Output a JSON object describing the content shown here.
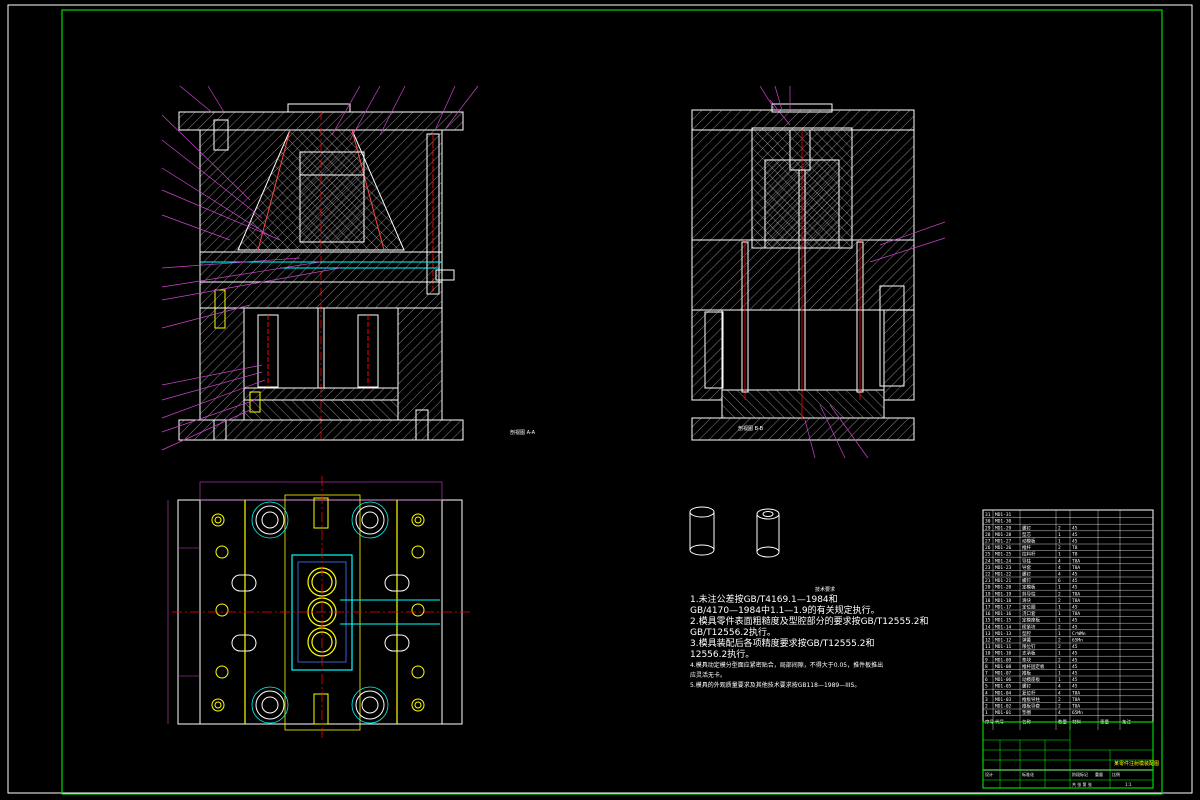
{
  "drawing": {
    "section_label_left": "剖视图 A-A",
    "section_label_right": "剖视图 B-B",
    "tech_requirements": {
      "heading": "技术要求",
      "lines": [
        "1.未注公差按GB/T4169.1—1984和",
        "GB/4170—1984中1.1—1.9的有关规定执行。",
        "2.模具零件表面粗糙度及型腔部分的要求按GB/T12555.2和",
        "GB/T12556.2执行。",
        "3.模具装配后各项精度要求按GB/T12555.2和",
        "12556.2执行。",
        "4.模具动定模分型面应紧密贴合，局部间隙，不得大于0.05，推件板推出",
        "应灵活无卡。",
        "5.模具的外观质量要求及其他技术要求按GB118—1989—IIIS。"
      ]
    },
    "title_block": {
      "drawing_title": "某零件注射模装配图",
      "rows_left": [
        "标记",
        "处数",
        "分区",
        "更改文件号",
        "签名",
        "年月日"
      ],
      "designer": "设计",
      "standard": "标准化",
      "stage": "阶段标记",
      "weight": "重量",
      "scale": "比例",
      "sheet": "共 张 第 张",
      "scale_value": "1:1"
    },
    "bom": {
      "headers": [
        "序号",
        "代号",
        "名称",
        "数量",
        "材料",
        "重量",
        "备注"
      ],
      "rows": [
        [
          "31",
          "MD1-31",
          "",
          "",
          "",
          ""
        ],
        [
          "30",
          "MD1-30",
          "",
          "",
          "",
          ""
        ],
        [
          "29",
          "MD1-29",
          "螺钉",
          "2",
          "45",
          ""
        ],
        [
          "28",
          "MD1-28",
          "型芯",
          "1",
          "45",
          ""
        ],
        [
          "27",
          "MD1-27",
          "动模板",
          "1",
          "45",
          ""
        ],
        [
          "26",
          "MD1-26",
          "推杆",
          "2",
          "T8",
          ""
        ],
        [
          "25",
          "MD1-25",
          "拉料杆",
          "1",
          "T8",
          ""
        ],
        [
          "24",
          "MD1-24",
          "导柱",
          "4",
          "T8A",
          ""
        ],
        [
          "23",
          "MD1-23",
          "导套",
          "4",
          "T8A",
          ""
        ],
        [
          "22",
          "MD1-22",
          "螺钉",
          "4",
          "45",
          ""
        ],
        [
          "21",
          "MD1-21",
          "螺钉",
          "6",
          "45",
          ""
        ],
        [
          "20",
          "MD1-20",
          "定模板",
          "1",
          "45",
          ""
        ],
        [
          "19",
          "MD1-19",
          "斜导柱",
          "2",
          "T8A",
          ""
        ],
        [
          "18",
          "MD1-18",
          "滑块",
          "2",
          "T8A",
          ""
        ],
        [
          "17",
          "MD1-17",
          "定位圈",
          "1",
          "45",
          ""
        ],
        [
          "16",
          "MD1-16",
          "浇口套",
          "1",
          "T8A",
          ""
        ],
        [
          "15",
          "MD1-15",
          "定模座板",
          "1",
          "45",
          ""
        ],
        [
          "14",
          "MD1-14",
          "楔紧块",
          "2",
          "45",
          ""
        ],
        [
          "13",
          "MD1-13",
          "型腔",
          "1",
          "CrWMn",
          ""
        ],
        [
          "12",
          "MD1-12",
          "弹簧",
          "2",
          "65Mn",
          ""
        ],
        [
          "11",
          "MD1-11",
          "限位钉",
          "2",
          "45",
          ""
        ],
        [
          "10",
          "MD1-10",
          "支承板",
          "1",
          "45",
          ""
        ],
        [
          "9",
          "MD1-09",
          "垫块",
          "2",
          "45",
          ""
        ],
        [
          "8",
          "MD1-08",
          "推杆固定板",
          "1",
          "45",
          ""
        ],
        [
          "7",
          "MD1-07",
          "推板",
          "1",
          "45",
          ""
        ],
        [
          "6",
          "MD1-06",
          "动模座板",
          "1",
          "45",
          ""
        ],
        [
          "5",
          "MD1-05",
          "螺钉",
          "4",
          "45",
          ""
        ],
        [
          "4",
          "MD1-04",
          "复位杆",
          "4",
          "T8A",
          ""
        ],
        [
          "3",
          "MD1-03",
          "推板导柱",
          "2",
          "T8A",
          ""
        ],
        [
          "2",
          "MD1-02",
          "推板导套",
          "2",
          "T8A",
          ""
        ],
        [
          "1",
          "MD1-01",
          "垫圈",
          "4",
          "65Mn",
          ""
        ]
      ]
    },
    "colors": {
      "border": "#00ff00",
      "outline": "#ffffff",
      "hatch": "#cccccc",
      "centerline": "#ff0000",
      "leader": "#cc44cc",
      "cyan": "#00ffff",
      "yellow": "#ffff00",
      "blue": "#4477ff",
      "magenta": "#ff44ff"
    }
  }
}
